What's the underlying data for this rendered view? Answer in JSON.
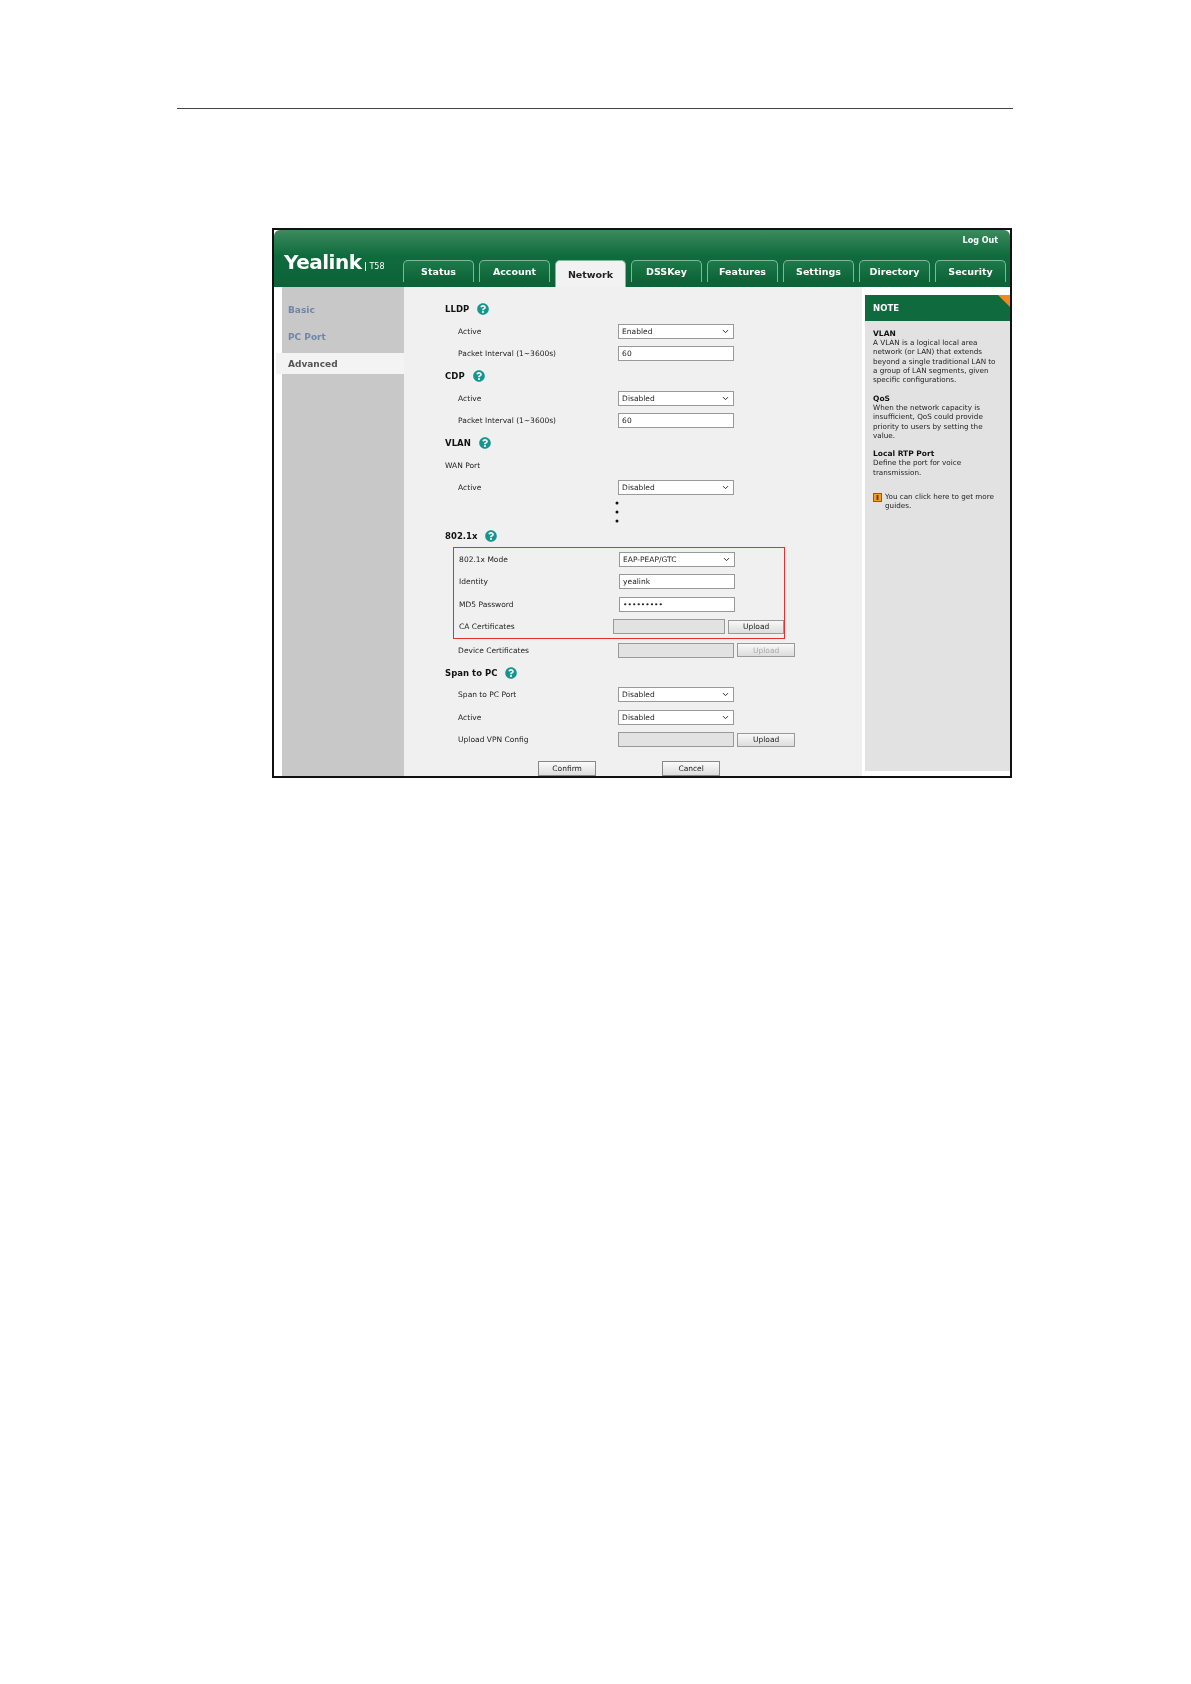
{
  "header": {
    "logo": "Yealink",
    "model": "T58",
    "logout": "Log Out"
  },
  "tabs": [
    {
      "label": "Status",
      "selected": false
    },
    {
      "label": "Account",
      "selected": false
    },
    {
      "label": "Network",
      "selected": true
    },
    {
      "label": "DSSKey",
      "selected": false
    },
    {
      "label": "Features",
      "selected": false
    },
    {
      "label": "Settings",
      "selected": false
    },
    {
      "label": "Directory",
      "selected": false
    },
    {
      "label": "Security",
      "selected": false
    }
  ],
  "sidebar": {
    "items": [
      {
        "label": "Basic",
        "selected": false
      },
      {
        "label": "PC Port",
        "selected": false
      },
      {
        "label": "Advanced",
        "selected": true
      }
    ]
  },
  "sections": [
    {
      "title": "LLDP",
      "rows": [
        {
          "kind": "select",
          "label": "Active",
          "value": "Enabled",
          "highlighted": false
        },
        {
          "kind": "text",
          "label": "Packet Interval (1~3600s)",
          "value": "60",
          "highlighted": false
        }
      ]
    },
    {
      "title": "CDP",
      "rows": [
        {
          "kind": "select",
          "label": "Active",
          "value": "Disabled",
          "highlighted": false
        },
        {
          "kind": "text",
          "label": "Packet Interval (1~3600s)",
          "value": "60",
          "highlighted": false
        }
      ]
    },
    {
      "title": "VLAN",
      "rows": [
        {
          "kind": "subheading",
          "label": "WAN Port",
          "highlighted": false
        },
        {
          "kind": "select",
          "label": "Active",
          "value": "Disabled",
          "highlighted": false
        },
        {
          "kind": "gap",
          "highlighted": false
        }
      ]
    },
    {
      "title": "802.1x",
      "rows": [
        {
          "kind": "select",
          "label": "802.1x Mode",
          "value": "EAP-PEAP/GTC",
          "highlighted": true
        },
        {
          "kind": "text",
          "label": "Identity",
          "value": "yealink",
          "highlighted": true
        },
        {
          "kind": "text",
          "label": "MD5 Password",
          "value": "•••••••••",
          "highlighted": true
        },
        {
          "kind": "file",
          "label": "CA Certificates",
          "button": "Upload",
          "disabled": false,
          "highlighted": true
        },
        {
          "kind": "file",
          "label": "Device Certificates",
          "button": "Upload",
          "disabled": true,
          "highlighted": false
        }
      ]
    },
    {
      "title": "Span to PC",
      "rows": [
        {
          "kind": "select",
          "label": "Span to PC Port",
          "value": "Disabled",
          "highlighted": false
        },
        {
          "kind": "select",
          "label": "Active",
          "value": "Disabled",
          "highlighted": false
        },
        {
          "kind": "file",
          "label": "Upload VPN Config",
          "button": "Upload",
          "disabled": false,
          "highlighted": false
        }
      ]
    }
  ],
  "actions": [
    "Confirm",
    "Cancel"
  ],
  "note": {
    "title": "NOTE",
    "items": [
      {
        "title": "VLAN",
        "text": "A VLAN is a logical local area network (or LAN) that extends beyond a single traditional LAN to a group of LAN segments, given specific configurations."
      },
      {
        "title": "QoS",
        "text": "When the network capacity is insufficient, QoS could provide priority to users by setting the value."
      },
      {
        "title": "Local RTP Port",
        "text": "Define the port for voice transmission."
      }
    ],
    "guide": "You can click here to get more guides."
  }
}
